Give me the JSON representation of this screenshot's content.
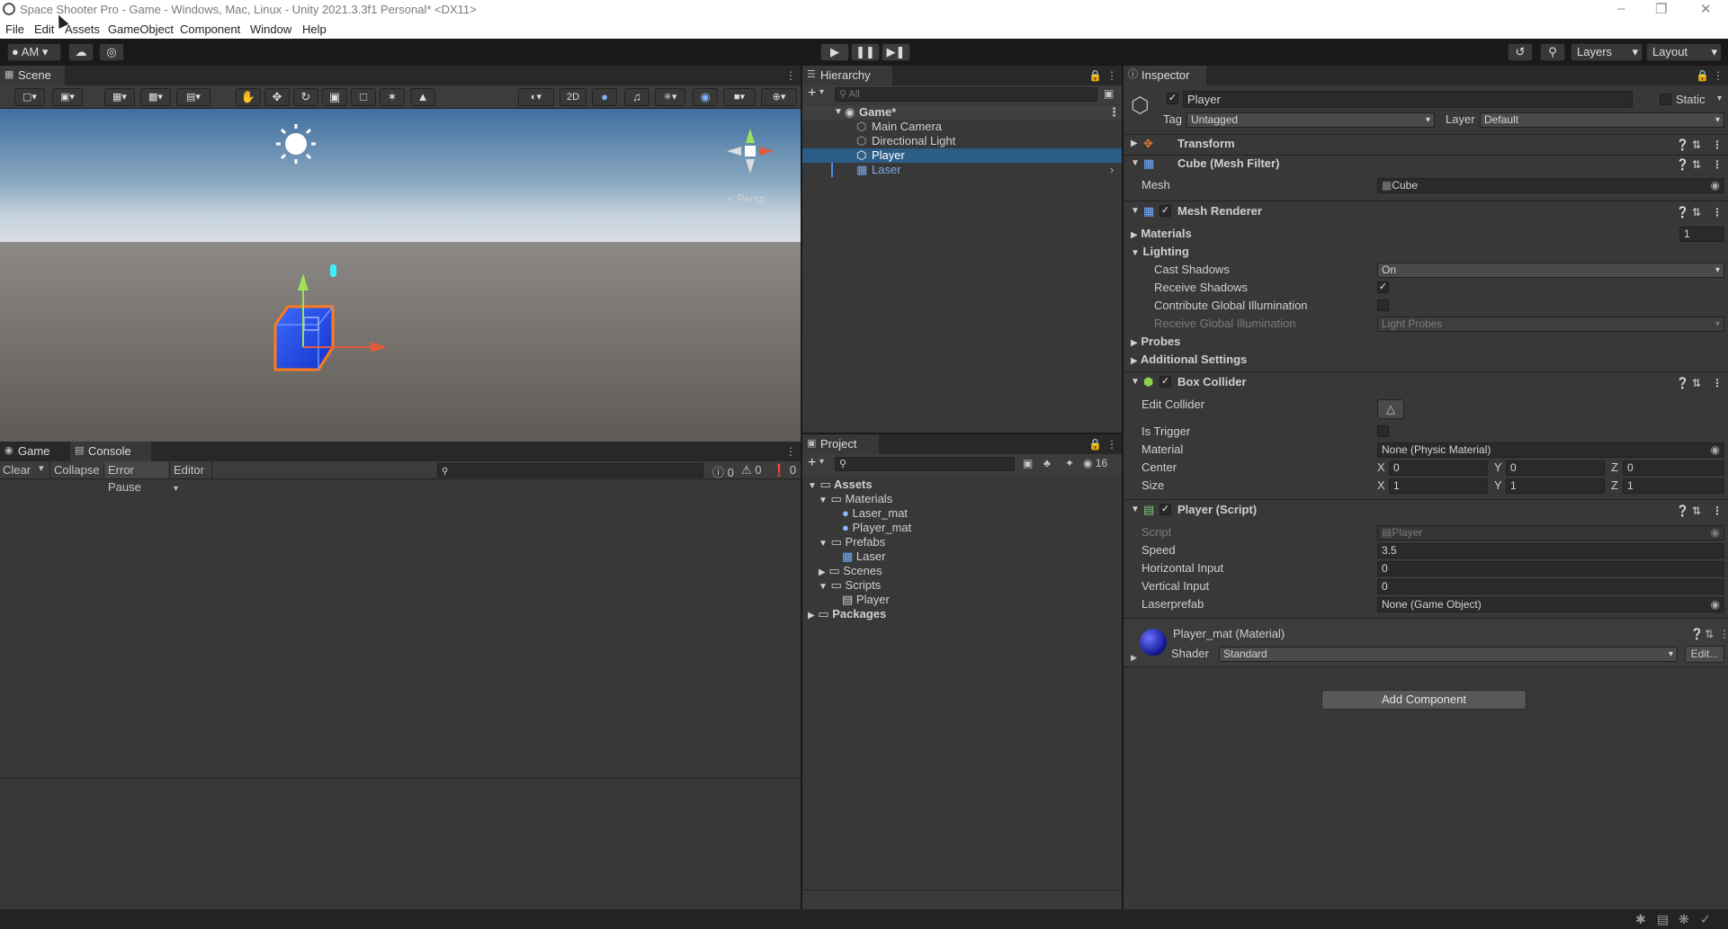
{
  "window": {
    "title": "Space Shooter Pro - Game - Windows, Mac, Linux - Unity 2021.3.3f1 Personal* <DX11>"
  },
  "menu": [
    "File",
    "Edit",
    "Assets",
    "GameObject",
    "Component",
    "Window",
    "Help"
  ],
  "toolbar": {
    "account": "AM",
    "layers": "Layers",
    "layout": "Layout"
  },
  "scene": {
    "tab": "Scene",
    "mode2d": "2D",
    "persp": "< Persp"
  },
  "game_tabs": {
    "game": "Game",
    "console": "Console"
  },
  "console": {
    "clear": "Clear",
    "collapse": "Collapse",
    "error_pause": "Error Pause",
    "editor": "Editor",
    "info_count": "0",
    "warn_count": "0",
    "error_count": "0"
  },
  "hierarchy": {
    "tab": "Hierarchy",
    "search_placeholder": "All",
    "scene": "Game*",
    "items": [
      "Main Camera",
      "Directional Light",
      "Player",
      "Laser"
    ]
  },
  "project": {
    "tab": "Project",
    "hidden_count": "16",
    "tree": {
      "assets": "Assets",
      "materials": "Materials",
      "laser_mat": "Laser_mat",
      "player_mat": "Player_mat",
      "prefabs": "Prefabs",
      "laser": "Laser",
      "scenes": "Scenes",
      "scripts": "Scripts",
      "player": "Player",
      "packages": "Packages"
    }
  },
  "inspector": {
    "tab": "Inspector",
    "object_name": "Player",
    "static_label": "Static",
    "tag_label": "Tag",
    "tag_value": "Untagged",
    "layer_label": "Layer",
    "layer_value": "Default",
    "transform": "Transform",
    "mesh_filter": {
      "title": "Cube (Mesh Filter)",
      "mesh_label": "Mesh",
      "mesh_value": "Cube"
    },
    "mesh_renderer": {
      "title": "Mesh Renderer",
      "materials": "Materials",
      "materials_count": "1",
      "lighting": "Lighting",
      "cast_shadows": "Cast Shadows",
      "cast_shadows_value": "On",
      "receive_shadows": "Receive Shadows",
      "contribute_gi": "Contribute Global Illumination",
      "receive_gi": "Receive Global Illumination",
      "receive_gi_value": "Light Probes",
      "probes": "Probes",
      "additional": "Additional Settings"
    },
    "box_collider": {
      "title": "Box Collider",
      "edit_collider": "Edit Collider",
      "is_trigger": "Is Trigger",
      "material": "Material",
      "material_value": "None (Physic Material)",
      "center": "Center",
      "size": "Size",
      "center_values": [
        "0",
        "0",
        "0"
      ],
      "size_values": [
        "1",
        "1",
        "1"
      ],
      "axis": [
        "X",
        "Y",
        "Z"
      ]
    },
    "player_script": {
      "title": "Player (Script)",
      "script": "Script",
      "script_value": "Player",
      "speed": "Speed",
      "speed_value": "3.5",
      "horizontal": "Horizontal Input",
      "horizontal_value": "0",
      "vertical": "Vertical Input",
      "vertical_value": "0",
      "laserprefab": "Laserprefab",
      "laserprefab_value": "None (Game Object)"
    },
    "material": {
      "title": "Player_mat (Material)",
      "shader_label": "Shader",
      "shader_value": "Standard",
      "edit": "Edit..."
    },
    "add_component": "Add Component"
  },
  "colors": {
    "selection": "#2c5d87",
    "panel": "#383838",
    "field": "#2a2a2a",
    "accent": "#4d8df0"
  }
}
